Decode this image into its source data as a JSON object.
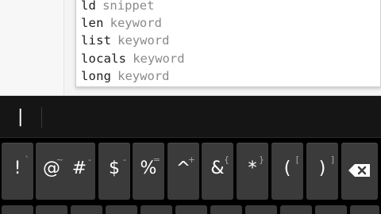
{
  "autocomplete": {
    "items": [
      {
        "word": "ld",
        "kind": "snippet"
      },
      {
        "word": "len",
        "kind": "keyword"
      },
      {
        "word": "list",
        "kind": "keyword"
      },
      {
        "word": "locals",
        "kind": "keyword"
      },
      {
        "word": "long",
        "kind": "keyword"
      }
    ]
  },
  "suggestion_bar": {
    "current": "|"
  },
  "keyboard": {
    "keys": [
      {
        "main": "!",
        "sub": "`"
      },
      {
        "main": "@",
        "sub": "~"
      },
      {
        "main": "#",
        "sub": "-"
      },
      {
        "main": "$",
        "sub": "-"
      },
      {
        "main": "%",
        "sub": "="
      },
      {
        "main": "^",
        "sub": "+"
      },
      {
        "main": "&",
        "sub": "{"
      },
      {
        "main": "*",
        "sub": "}"
      },
      {
        "main": "(",
        "sub": "["
      },
      {
        "main": ")",
        "sub": "]"
      }
    ],
    "backspace_icon": "backspace-icon"
  },
  "colors": {
    "keyboard_bg": "#000000",
    "key_bg": "#3b3b3b",
    "editor_bg": "#f4f4f4",
    "popup_bg": "#ffffff"
  }
}
